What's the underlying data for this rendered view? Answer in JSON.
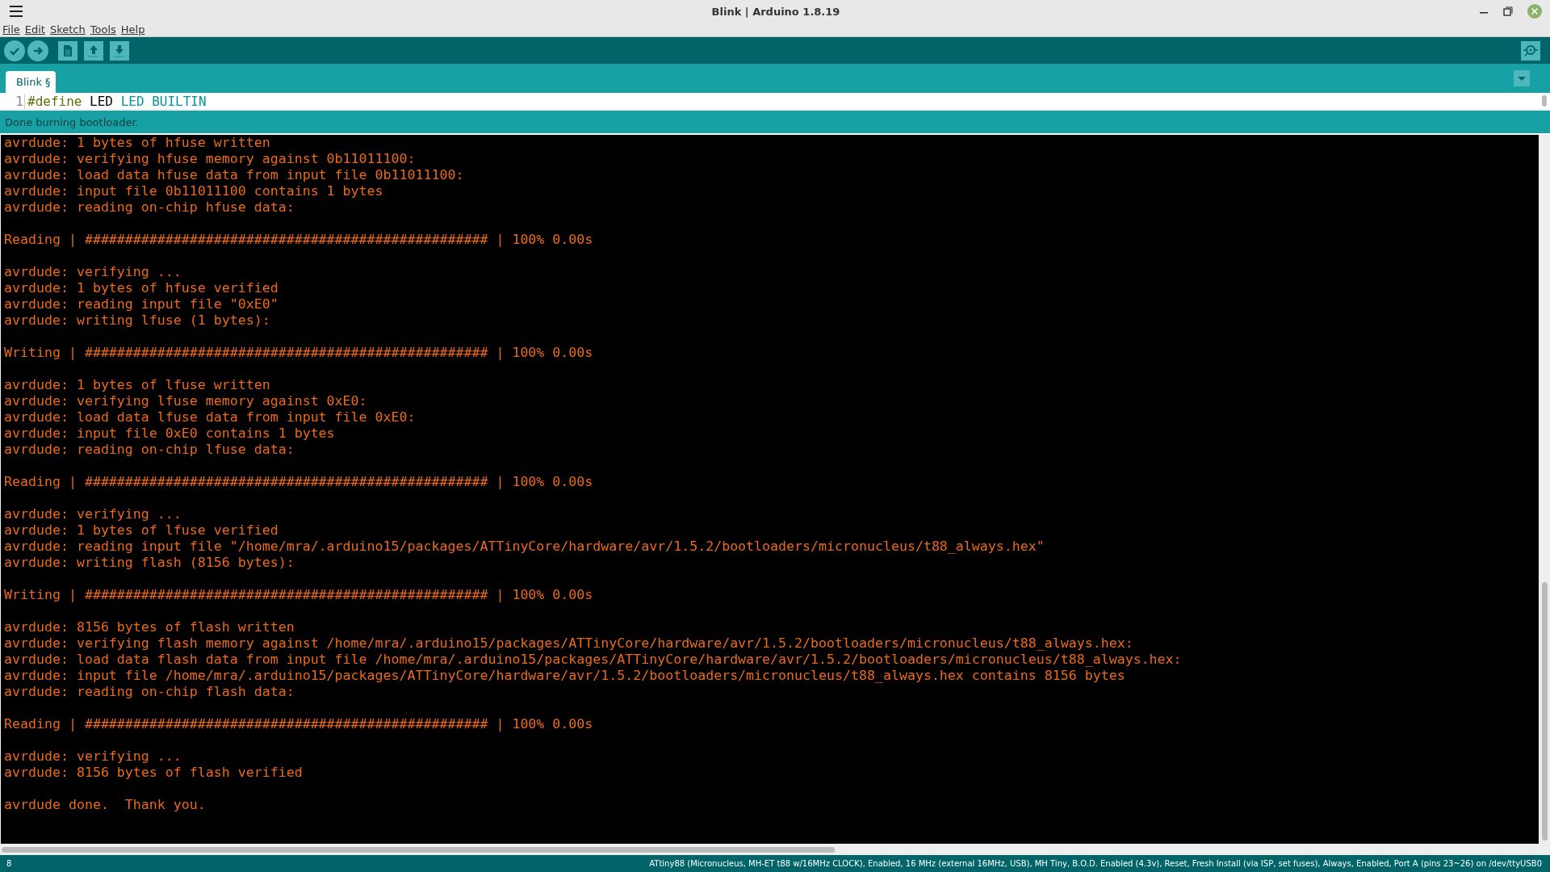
{
  "window": {
    "title": "Blink | Arduino 1.8.19"
  },
  "menu": [
    "File",
    "Edit",
    "Sketch",
    "Tools",
    "Help"
  ],
  "tabs": [
    {
      "label": "Blink §",
      "selected": true
    }
  ],
  "editor": {
    "line_number": "1",
    "tokens": [
      {
        "text": "#define",
        "kind": "directive"
      },
      {
        "text": "LED",
        "kind": "plain"
      },
      {
        "text": "LED BUILTIN",
        "kind": "constant"
      }
    ]
  },
  "status": {
    "message": "Done burning bootloader."
  },
  "console": {
    "blocks": [
      [
        "avrdude: 1 bytes of hfuse written",
        "avrdude: verifying hfuse memory against 0b11011100:",
        "avrdude: load data hfuse data from input file 0b11011100:",
        "avrdude: input file 0b11011100 contains 1 bytes",
        "avrdude: reading on-chip hfuse data:"
      ],
      [
        "Reading | ################################################## | 100% 0.00s"
      ],
      [
        "avrdude: verifying ...",
        "avrdude: 1 bytes of hfuse verified",
        "avrdude: reading input file \"0xE0\"",
        "avrdude: writing lfuse (1 bytes):"
      ],
      [
        "Writing | ################################################## | 100% 0.00s"
      ],
      [
        "avrdude: 1 bytes of lfuse written",
        "avrdude: verifying lfuse memory against 0xE0:",
        "avrdude: load data lfuse data from input file 0xE0:",
        "avrdude: input file 0xE0 contains 1 bytes",
        "avrdude: reading on-chip lfuse data:"
      ],
      [
        "Reading | ################################################## | 100% 0.00s"
      ],
      [
        "avrdude: verifying ...",
        "avrdude: 1 bytes of lfuse verified",
        "avrdude: reading input file \"/home/mra/.arduino15/packages/ATTinyCore/hardware/avr/1.5.2/bootloaders/micronucleus/t88_always.hex\"",
        "avrdude: writing flash (8156 bytes):"
      ],
      [
        "Writing | ################################################## | 100% 0.00s"
      ],
      [
        "avrdude: 8156 bytes of flash written",
        "avrdude: verifying flash memory against /home/mra/.arduino15/packages/ATTinyCore/hardware/avr/1.5.2/bootloaders/micronucleus/t88_always.hex:",
        "avrdude: load data flash data from input file /home/mra/.arduino15/packages/ATTinyCore/hardware/avr/1.5.2/bootloaders/micronucleus/t88_always.hex:",
        "avrdude: input file /home/mra/.arduino15/packages/ATTinyCore/hardware/avr/1.5.2/bootloaders/micronucleus/t88_always.hex contains 8156 bytes",
        "avrdude: reading on-chip flash data:"
      ],
      [
        "Reading | ################################################## | 100% 0.00s"
      ],
      [
        "avrdude: verifying ...",
        "avrdude: 8156 bytes of flash verified"
      ],
      [
        "avrdude done.  Thank you."
      ]
    ]
  },
  "status_bar": {
    "line": "8",
    "board": "ATtiny88 (Micronucleus, MH-ET t88 w/16MHz CLOCK), Enabled, 16 MHz (external 16MHz, USB), MH Tiny, B.O.D. Enabled (4.3v), Reset, Fresh Install (via ISP, set fuses), Always, Enabled, Port A (pins 23~26) on /dev/ttyUSB0"
  }
}
